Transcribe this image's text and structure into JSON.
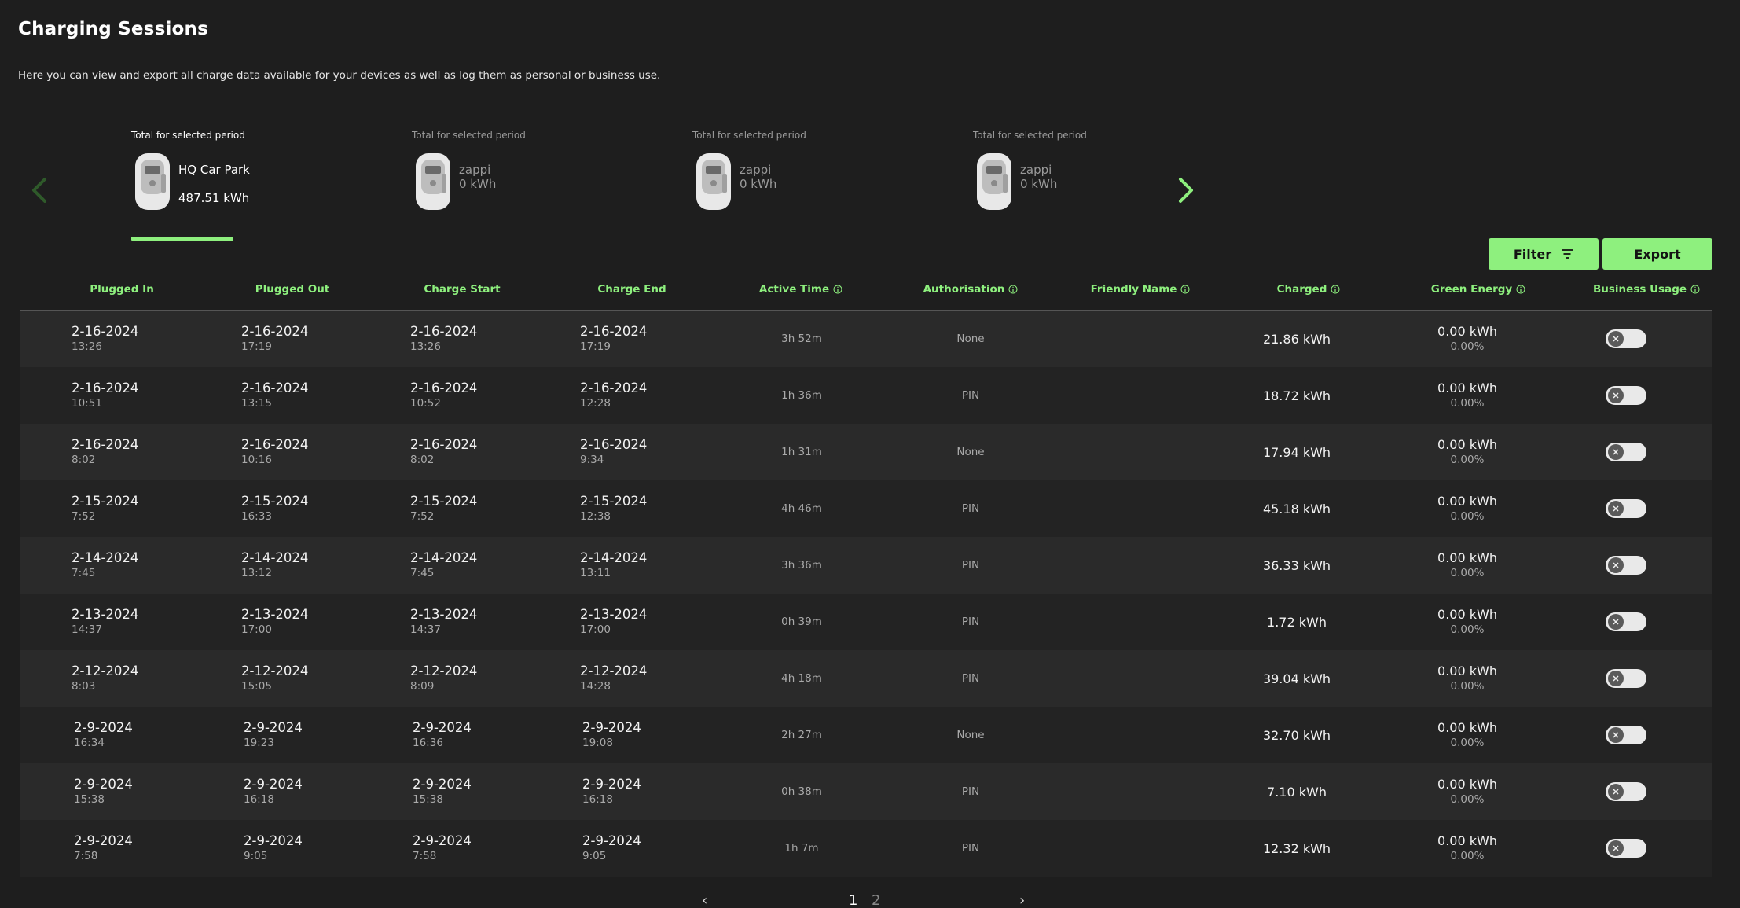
{
  "page": {
    "title": "Charging Sessions",
    "description": "Here you can view and export all charge data available for your devices as well as log them as personal or business use."
  },
  "devices": [
    {
      "period_label": "Total for selected period",
      "name": "HQ Car Park",
      "total": "487.51 kWh",
      "selected": true
    },
    {
      "period_label": "Total for selected period",
      "name": "zappi",
      "total": "0 kWh",
      "selected": false
    },
    {
      "period_label": "Total for selected period",
      "name": "zappi",
      "total": "0 kWh",
      "selected": false
    },
    {
      "period_label": "Total for selected period",
      "name": "zappi",
      "total": "0 kWh",
      "selected": false
    }
  ],
  "toolbar": {
    "filter_label": "Filter",
    "export_label": "Export"
  },
  "columns": {
    "plugged_in": "Plugged In",
    "plugged_out": "Plugged Out",
    "charge_start": "Charge Start",
    "charge_end": "Charge End",
    "active_time": "Active Time",
    "authorisation": "Authorisation",
    "friendly_name": "Friendly Name",
    "charged": "Charged",
    "green_energy": "Green Energy",
    "business_usage": "Business Usage"
  },
  "sessions": [
    {
      "plugged_in": {
        "date": "2-16-2024",
        "time": "13:26"
      },
      "plugged_out": {
        "date": "2-16-2024",
        "time": "17:19"
      },
      "charge_start": {
        "date": "2-16-2024",
        "time": "13:26"
      },
      "charge_end": {
        "date": "2-16-2024",
        "time": "17:19"
      },
      "active_time": "3h 52m",
      "authorisation": "None",
      "friendly_name": "",
      "charged": "21.86 kWh",
      "green_kwh": "0.00 kWh",
      "green_pct": "0.00%",
      "business": false
    },
    {
      "plugged_in": {
        "date": "2-16-2024",
        "time": "10:51"
      },
      "plugged_out": {
        "date": "2-16-2024",
        "time": "13:15"
      },
      "charge_start": {
        "date": "2-16-2024",
        "time": "10:52"
      },
      "charge_end": {
        "date": "2-16-2024",
        "time": "12:28"
      },
      "active_time": "1h 36m",
      "authorisation": "PIN",
      "friendly_name": "",
      "charged": "18.72 kWh",
      "green_kwh": "0.00 kWh",
      "green_pct": "0.00%",
      "business": false
    },
    {
      "plugged_in": {
        "date": "2-16-2024",
        "time": "8:02"
      },
      "plugged_out": {
        "date": "2-16-2024",
        "time": "10:16"
      },
      "charge_start": {
        "date": "2-16-2024",
        "time": "8:02"
      },
      "charge_end": {
        "date": "2-16-2024",
        "time": "9:34"
      },
      "active_time": "1h 31m",
      "authorisation": "None",
      "friendly_name": "",
      "charged": "17.94 kWh",
      "green_kwh": "0.00 kWh",
      "green_pct": "0.00%",
      "business": false
    },
    {
      "plugged_in": {
        "date": "2-15-2024",
        "time": "7:52"
      },
      "plugged_out": {
        "date": "2-15-2024",
        "time": "16:33"
      },
      "charge_start": {
        "date": "2-15-2024",
        "time": "7:52"
      },
      "charge_end": {
        "date": "2-15-2024",
        "time": "12:38"
      },
      "active_time": "4h 46m",
      "authorisation": "PIN",
      "friendly_name": "",
      "charged": "45.18 kWh",
      "green_kwh": "0.00 kWh",
      "green_pct": "0.00%",
      "business": false
    },
    {
      "plugged_in": {
        "date": "2-14-2024",
        "time": "7:45"
      },
      "plugged_out": {
        "date": "2-14-2024",
        "time": "13:12"
      },
      "charge_start": {
        "date": "2-14-2024",
        "time": "7:45"
      },
      "charge_end": {
        "date": "2-14-2024",
        "time": "13:11"
      },
      "active_time": "3h 36m",
      "authorisation": "PIN",
      "friendly_name": "",
      "charged": "36.33 kWh",
      "green_kwh": "0.00 kWh",
      "green_pct": "0.00%",
      "business": false
    },
    {
      "plugged_in": {
        "date": "2-13-2024",
        "time": "14:37"
      },
      "plugged_out": {
        "date": "2-13-2024",
        "time": "17:00"
      },
      "charge_start": {
        "date": "2-13-2024",
        "time": "14:37"
      },
      "charge_end": {
        "date": "2-13-2024",
        "time": "17:00"
      },
      "active_time": "0h 39m",
      "authorisation": "PIN",
      "friendly_name": "",
      "charged": "1.72 kWh",
      "green_kwh": "0.00 kWh",
      "green_pct": "0.00%",
      "business": false
    },
    {
      "plugged_in": {
        "date": "2-12-2024",
        "time": "8:03"
      },
      "plugged_out": {
        "date": "2-12-2024",
        "time": "15:05"
      },
      "charge_start": {
        "date": "2-12-2024",
        "time": "8:09"
      },
      "charge_end": {
        "date": "2-12-2024",
        "time": "14:28"
      },
      "active_time": "4h 18m",
      "authorisation": "PIN",
      "friendly_name": "",
      "charged": "39.04 kWh",
      "green_kwh": "0.00 kWh",
      "green_pct": "0.00%",
      "business": false
    },
    {
      "plugged_in": {
        "date": "2-9-2024",
        "time": "16:34"
      },
      "plugged_out": {
        "date": "2-9-2024",
        "time": "19:23"
      },
      "charge_start": {
        "date": "2-9-2024",
        "time": "16:36"
      },
      "charge_end": {
        "date": "2-9-2024",
        "time": "19:08"
      },
      "active_time": "2h 27m",
      "authorisation": "None",
      "friendly_name": "",
      "charged": "32.70 kWh",
      "green_kwh": "0.00 kWh",
      "green_pct": "0.00%",
      "business": false
    },
    {
      "plugged_in": {
        "date": "2-9-2024",
        "time": "15:38"
      },
      "plugged_out": {
        "date": "2-9-2024",
        "time": "16:18"
      },
      "charge_start": {
        "date": "2-9-2024",
        "time": "15:38"
      },
      "charge_end": {
        "date": "2-9-2024",
        "time": "16:18"
      },
      "active_time": "0h 38m",
      "authorisation": "PIN",
      "friendly_name": "",
      "charged": "7.10 kWh",
      "green_kwh": "0.00 kWh",
      "green_pct": "0.00%",
      "business": false
    },
    {
      "plugged_in": {
        "date": "2-9-2024",
        "time": "7:58"
      },
      "plugged_out": {
        "date": "2-9-2024",
        "time": "9:05"
      },
      "charge_start": {
        "date": "2-9-2024",
        "time": "7:58"
      },
      "charge_end": {
        "date": "2-9-2024",
        "time": "9:05"
      },
      "active_time": "1h 7m",
      "authorisation": "PIN",
      "friendly_name": "",
      "charged": "12.32 kWh",
      "green_kwh": "0.00 kWh",
      "green_pct": "0.00%",
      "business": false
    }
  ],
  "pagination": {
    "prev": "‹",
    "pages": [
      "1",
      "2"
    ],
    "next": "›",
    "current": "1"
  },
  "icons": {
    "carousel_prev": "chevron-left-icon",
    "carousel_next": "chevron-right-icon",
    "device": "zappi-charger-icon",
    "filter": "filter-lines-icon",
    "info": "info-circle-icon",
    "toggle_off": "close-icon"
  },
  "colors": {
    "accent": "#8ef07e",
    "background": "#1e1e1e",
    "row_odd": "#2a2a2a",
    "row_even": "#232323",
    "muted_arrow": "#2f5a2a"
  }
}
